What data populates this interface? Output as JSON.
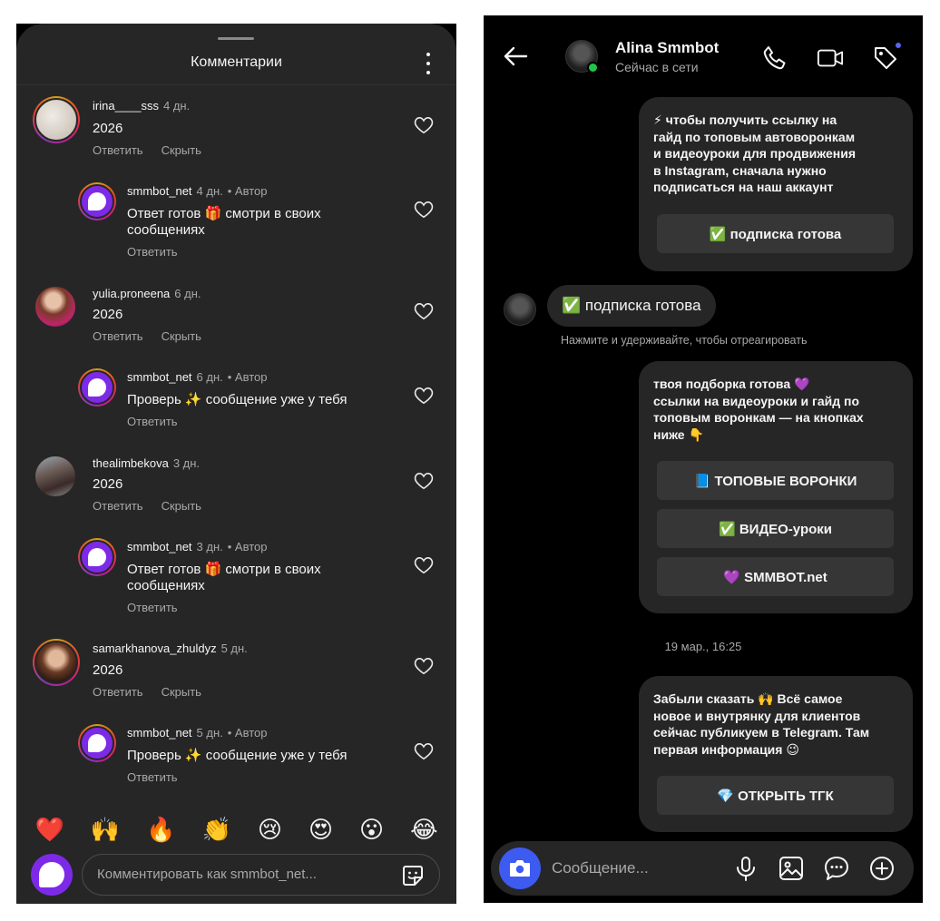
{
  "left": {
    "title": "Комментарии",
    "comments": [
      {
        "user": "irina____sss",
        "ago": "4 дн.",
        "text": "2026",
        "reply": "Ответить",
        "hide": "Скрыть"
      },
      {
        "user": "smmbot_net",
        "ago": "4 дн.",
        "author": "• Автор",
        "text": "Ответ готов 🎁 смотри в своих\nсообщениях",
        "reply": "Ответить"
      },
      {
        "user": "yulia.proneena",
        "ago": "6 дн.",
        "text": "2026",
        "reply": "Ответить",
        "hide": "Скрыть"
      },
      {
        "user": "smmbot_net",
        "ago": "6 дн.",
        "author": "• Автор",
        "text": "Проверь ✨ сообщение уже у тебя",
        "reply": "Ответить"
      },
      {
        "user": "thealimbekova",
        "ago": "3 дн.",
        "text": "2026",
        "reply": "Ответить",
        "hide": "Скрыть"
      },
      {
        "user": "smmbot_net",
        "ago": "3 дн.",
        "author": "• Автор",
        "text": "Ответ готов 🎁 смотри в своих\nсообщениях",
        "reply": "Ответить"
      },
      {
        "user": "samarkhanova_zhuldyz",
        "ago": "5 дн.",
        "text": "2026",
        "reply": "Ответить",
        "hide": "Скрыть"
      },
      {
        "user": "smmbot_net",
        "ago": "5 дн.",
        "author": "• Автор",
        "text": "Проверь ✨ сообщение уже у тебя",
        "reply": "Ответить"
      }
    ],
    "emojis": [
      "❤️",
      "🙌",
      "🔥",
      "👏",
      "😢",
      "😍",
      "😮",
      "😂"
    ],
    "composer_placeholder": "Комментировать как smmbot_net..."
  },
  "right": {
    "name": "Alina Smmbot",
    "status": "Сейчас в сети",
    "messages": [
      {
        "text": "⚡ чтобы получить ссылку на\nгайд по топовым автоворонкам\nи видеоуроки для продвижения\nв Instagram, сначала нужно\nподписаться на наш аккаунт",
        "buttons": [
          "✅ подписка готова"
        ]
      },
      {
        "text": "твоя подборка готова 💜\nссылки на видеоуроки и гайд по\nтоповым воронкам — на кнопках\nниже 👇",
        "buttons": [
          "📘 ТОПОВЫЕ ВОРОНКИ",
          "✅ ВИДЕО-уроки",
          "💜 SMMBOT.net"
        ]
      },
      {
        "text": "Забыли сказать 🙌 Всё самое\nновое и внутрянку для клиентов\nсейчас публикуем в Telegram. Там\nпервая информация 😉",
        "buttons": [
          "💎 ОТКРЫТЬ ТГК"
        ]
      }
    ],
    "received": "✅ подписка готова",
    "hint": "Нажмите и удерживайте, чтобы отреагировать",
    "timestamp": "19 мар., 16:25",
    "composer_placeholder": "Сообщение..."
  },
  "colors": {
    "accent_blue": "#3d5af1",
    "online": "#20c54a",
    "bot_purple": "#7d2ae8"
  }
}
